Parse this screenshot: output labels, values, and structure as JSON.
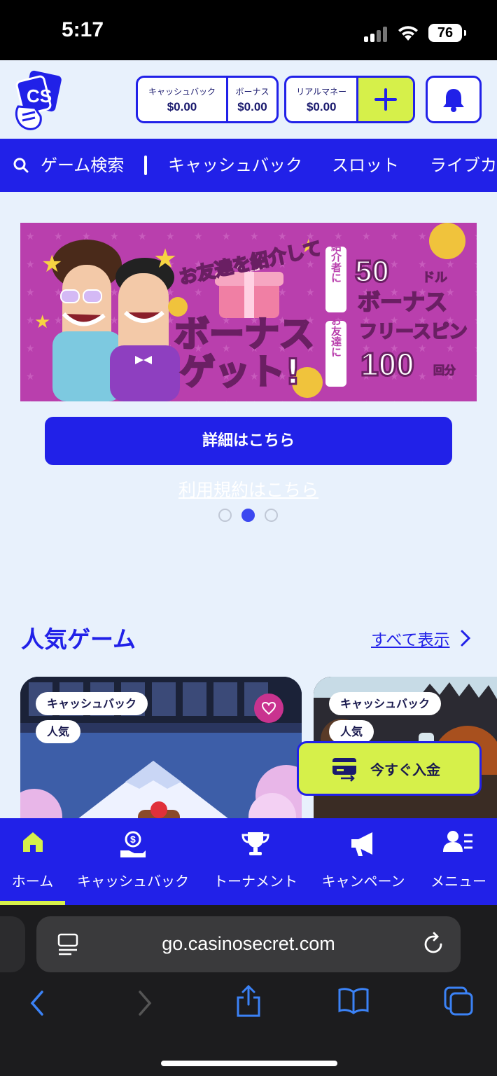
{
  "status": {
    "time": "5:17",
    "battery": "76"
  },
  "wallet": {
    "cashback_label": "キャッシュバック",
    "cashback_value": "$0.00",
    "bonus_label": "ボーナス",
    "bonus_value": "$0.00",
    "real_money_label": "リアルマネー",
    "real_money_value": "$0.00"
  },
  "category_nav": {
    "search": "ゲーム検索",
    "items": [
      "キャッシュバック",
      "スロット",
      "ライブカ"
    ]
  },
  "banner": {
    "headline_top": "お友達を紹介して",
    "headline_main": "ボーナス",
    "headline_sub": "ゲット!",
    "referrer_label": "紹介者に",
    "referrer_amount": "50",
    "referrer_unit": "ドル",
    "referrer_reward": "ボーナス",
    "friend_label": "お友達に",
    "friend_reward": "フリースピン",
    "friend_amount": "100",
    "friend_unit": "回分"
  },
  "promo": {
    "detail_button": "詳細はこちら",
    "terms_link": "利用規約はこちら",
    "carousel": {
      "count": 3,
      "active": 2
    }
  },
  "popular": {
    "title": "人気ゲーム",
    "see_all": "すべて表示",
    "cards": [
      {
        "tags": [
          "キャッシュバック",
          "人気"
        ]
      },
      {
        "tags": [
          "キャッシュバック",
          "人気"
        ]
      }
    ]
  },
  "deposit_button": "今すぐ入金",
  "bottom_nav": {
    "items": [
      "ホーム",
      "キャッシュバック",
      "トーナメント",
      "キャンペーン",
      "メニュー"
    ],
    "active": "ホーム"
  },
  "browser": {
    "url": "go.casinosecret.com"
  },
  "colors": {
    "brand_blue": "#2121e8",
    "accent_lime": "#d6f04a",
    "banner_pink": "#b93fad",
    "page_bg": "#e8f1fc"
  }
}
